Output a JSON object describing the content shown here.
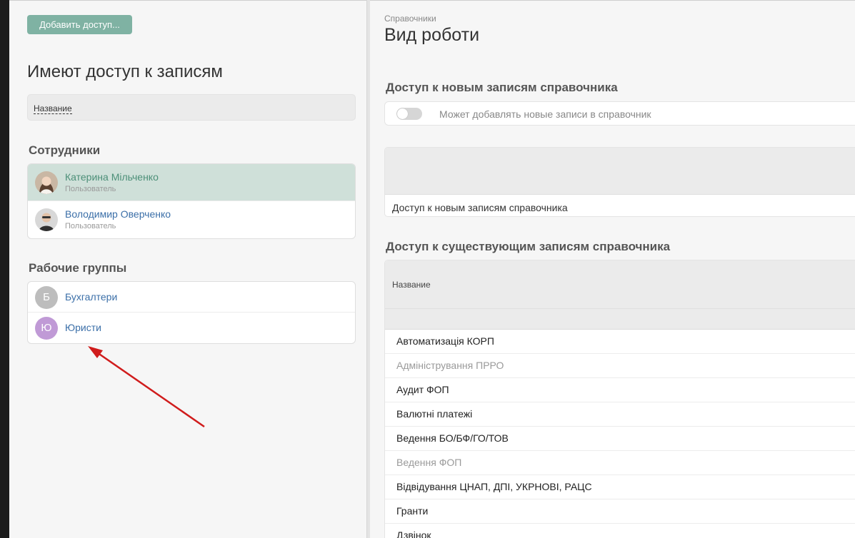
{
  "left_panel": {
    "add_button_label": "Добавить доступ...",
    "title": "Имеют доступ к записям",
    "filter_label": "Название",
    "employees_label": "Сотрудники",
    "employees": [
      {
        "name": "Катерина Мільченко",
        "role": "Пользователь",
        "selected": true
      },
      {
        "name": "Володимир Оверченко",
        "role": "Пользователь",
        "selected": false
      }
    ],
    "groups_label": "Рабочие группы",
    "groups": [
      {
        "letter": "Б",
        "name": "Бухгалтери",
        "color": "#bdbdbd"
      },
      {
        "letter": "Ю",
        "name": "Юристи",
        "color": "#c09ad6"
      }
    ]
  },
  "right_panel": {
    "breadcrumb": "Справочники",
    "title": "Вид роботи",
    "new_access_title": "Доступ к новым записям справочника",
    "toggle_label": "Может добавлять новые записи в справочник",
    "toggle_on": false,
    "new_access_cell": "Доступ к новым записям справочника",
    "existing_access_title": "Доступ к существующим записям справочника",
    "existing_column_header": "Название",
    "existing_rows": [
      {
        "name": "Автоматизація КОРП",
        "muted": false
      },
      {
        "name": "Адміністрування ПРРО",
        "muted": true
      },
      {
        "name": "Аудит ФОП",
        "muted": false
      },
      {
        "name": "Валютні платежі",
        "muted": false
      },
      {
        "name": "Ведення БО/БФ/ГО/ТОВ",
        "muted": false
      },
      {
        "name": "Ведення ФОП",
        "muted": true
      },
      {
        "name": "Відвідування ЦНАП, ДПІ, УКРНОВІ, РАЦС",
        "muted": false
      },
      {
        "name": "Гранти",
        "muted": false
      },
      {
        "name": "Дзвінок",
        "muted": false
      }
    ]
  },
  "colors": {
    "accent": "#7fb2a3",
    "selected_row": "#cfe0d9",
    "link": "#3b6fa8",
    "annotation_arrow": "#d01c1c"
  }
}
